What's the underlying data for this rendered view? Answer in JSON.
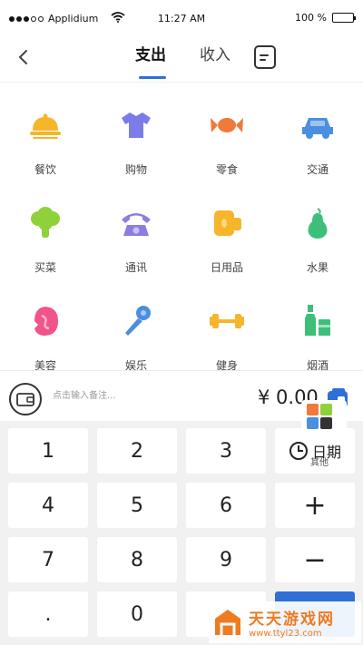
{
  "status_bar": {
    "carrier": "Applidium",
    "time": "11:27 AM",
    "battery": "100 %",
    "battery_level": 1.0,
    "signal_bars": 3,
    "signal_total": 5
  },
  "header": {
    "tabs": [
      {
        "label": "支出",
        "active": true
      },
      {
        "label": "收入",
        "active": false
      }
    ],
    "icons": {
      "back": "back-chevron-icon",
      "bill": "bill-list-icon"
    }
  },
  "categories": [
    {
      "label": "餐饮",
      "icon": "food-cloche-icon",
      "color": "#f5b62b"
    },
    {
      "label": "购物",
      "icon": "shirt-icon",
      "color": "#7b7ce8"
    },
    {
      "label": "零食",
      "icon": "candy-icon",
      "color": "#f07a3a"
    },
    {
      "label": "交通",
      "icon": "car-icon",
      "color": "#4a8fe0"
    },
    {
      "label": "买菜",
      "icon": "broccoli-icon",
      "color": "#8fd13a"
    },
    {
      "label": "通讯",
      "icon": "telephone-icon",
      "color": "#8a7fe0"
    },
    {
      "label": "日用品",
      "icon": "tissue-roll-icon",
      "color": "#f5b62b"
    },
    {
      "label": "水果",
      "icon": "pear-icon",
      "color": "#3dbf7a"
    },
    {
      "label": "美容",
      "icon": "face-icon",
      "color": "#f0548a"
    },
    {
      "label": "娱乐",
      "icon": "microphone-icon",
      "color": "#4a8fe0"
    },
    {
      "label": "健身",
      "icon": "dumbbell-icon",
      "color": "#f5b62b"
    },
    {
      "label": "烟酒",
      "icon": "bottle-icon",
      "color": "#3dbf7a"
    }
  ],
  "remark": {
    "placeholder": "点击输入备注...",
    "amount": "¥ 0.00"
  },
  "floating_widget": {
    "label": "其他",
    "colors": [
      "#f07a3a",
      "#8fd13a",
      "#4a8fe0",
      "#333333"
    ]
  },
  "keypad": {
    "keys": [
      "1",
      "2",
      "3",
      "日期",
      "4",
      "5",
      "6",
      "+",
      "7",
      "8",
      "9",
      "−",
      ".",
      "0"
    ],
    "date_label": "日期"
  },
  "watermark": {
    "title": "天天游戏网",
    "url": "www.ttyl23.com"
  },
  "colors": {
    "accent": "#2f6fd6",
    "keypad_bg": "#f1f1f1",
    "watermark": "#f07a1f"
  }
}
